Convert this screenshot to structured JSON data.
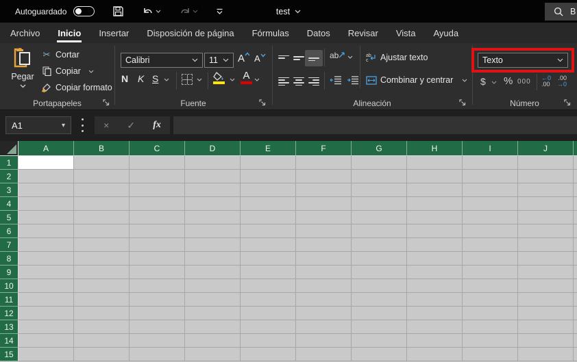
{
  "titlebar": {
    "autosave_label": "Autoguardado",
    "autosave_state": "off",
    "document_title": "test",
    "search_text": "B"
  },
  "tabs": {
    "items": [
      {
        "label": "Archivo",
        "selected": false
      },
      {
        "label": "Inicio",
        "selected": true
      },
      {
        "label": "Insertar",
        "selected": false
      },
      {
        "label": "Disposición de página",
        "selected": false
      },
      {
        "label": "Fórmulas",
        "selected": false
      },
      {
        "label": "Datos",
        "selected": false
      },
      {
        "label": "Revisar",
        "selected": false
      },
      {
        "label": "Vista",
        "selected": false
      },
      {
        "label": "Ayuda",
        "selected": false
      }
    ]
  },
  "ribbon": {
    "portapapeles": {
      "label": "Portapapeles",
      "pegar": "Pegar",
      "cortar": "Cortar",
      "copiar": "Copiar",
      "copiar_formato": "Copiar formato"
    },
    "fuente": {
      "label": "Fuente",
      "font_name": "Calibri",
      "font_size": "11",
      "bold": "N",
      "italic": "K",
      "underline": "S"
    },
    "alineacion": {
      "label": "Alineación",
      "orientation_text": "ab",
      "ajustar_texto": "Ajustar texto",
      "combinar_centrar": "Combinar y centrar"
    },
    "numero": {
      "label": "Número",
      "format_value": "Texto",
      "currency": "$",
      "percent": "%",
      "thousands": "000",
      "increase_decimal_top": "←0",
      "increase_decimal_bottom": ".00",
      "decrease_decimal_top": ".00",
      "decrease_decimal_bottom": "→0"
    }
  },
  "formula_bar": {
    "name_box": "A1",
    "fx_label": "fx",
    "cancel_glyph": "×",
    "enter_glyph": "✓"
  },
  "grid": {
    "columns": [
      "A",
      "B",
      "C",
      "D",
      "E",
      "F",
      "G",
      "H",
      "I",
      "J"
    ],
    "rows": [
      "1",
      "2",
      "3",
      "4",
      "5",
      "6",
      "7",
      "8",
      "9",
      "10",
      "11",
      "12",
      "13",
      "14",
      "15"
    ],
    "selected_cell": "A1"
  },
  "icons": {
    "scissors": "✂",
    "name_box_arrow": "▾"
  },
  "colors": {
    "excel_green": "#226b47",
    "annotation_red": "#df1313",
    "fill_yellow": "#ffe600",
    "font_red": "#e00000",
    "accent_blue": "#4aa3e0"
  }
}
